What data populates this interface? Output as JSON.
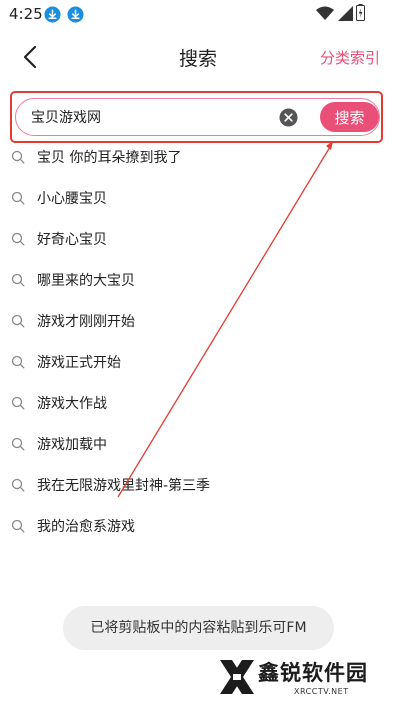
{
  "status_bar": {
    "time": "4:25",
    "icons": [
      "download-icon",
      "download-icon",
      "wifi-icon",
      "signal-icon",
      "battery-icon"
    ]
  },
  "header": {
    "back_icon": "chevron-left-icon",
    "title": "搜索",
    "category_link": "分类索引"
  },
  "search": {
    "value": "宝贝游戏网",
    "clear_icon": "clear-icon",
    "button_label": "搜索"
  },
  "suggestions": [
    "宝贝 你的耳朵撩到我了",
    "小心腰宝贝",
    "好奇心宝贝",
    "哪里来的大宝贝",
    "游戏才刚刚开始",
    "游戏正式开始",
    "游戏大作战",
    "游戏加载中",
    "我在无限游戏里封神-第三季",
    "我的治愈系游戏"
  ],
  "toast": {
    "text": "已将剪贴板中的内容粘贴到乐可FM"
  },
  "watermark": {
    "title": "鑫锐软件园",
    "subtitle": "XRCCTV.NET"
  },
  "colors": {
    "accent": "#ea4f78",
    "annotation": "#e13b34",
    "toast_bg": "#eeeeee"
  }
}
